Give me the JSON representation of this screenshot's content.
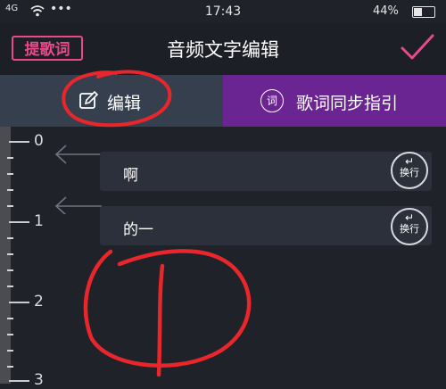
{
  "status_bar": {
    "signal": "4G",
    "time": "17:43",
    "battery": "44%",
    "battery_level": 0.44
  },
  "header": {
    "lyric_button": "提歌词",
    "title": "音频文字编辑"
  },
  "tabs": [
    {
      "label": "编辑"
    },
    {
      "label": "歌词同步指引",
      "icon_text": "词"
    }
  ],
  "ruler": {
    "labels": [
      "0",
      "1",
      "2",
      "3"
    ]
  },
  "lyrics": [
    {
      "text": "啊",
      "button_label": "换行",
      "button_icon": "↵"
    },
    {
      "text": "的一",
      "button_label": "换行",
      "button_icon": "↵"
    }
  ],
  "colors": {
    "accent": "#e84a8c",
    "sync_tab": "#6a2593",
    "edit_tab": "#363f4d",
    "annotation": "#e8262b"
  }
}
